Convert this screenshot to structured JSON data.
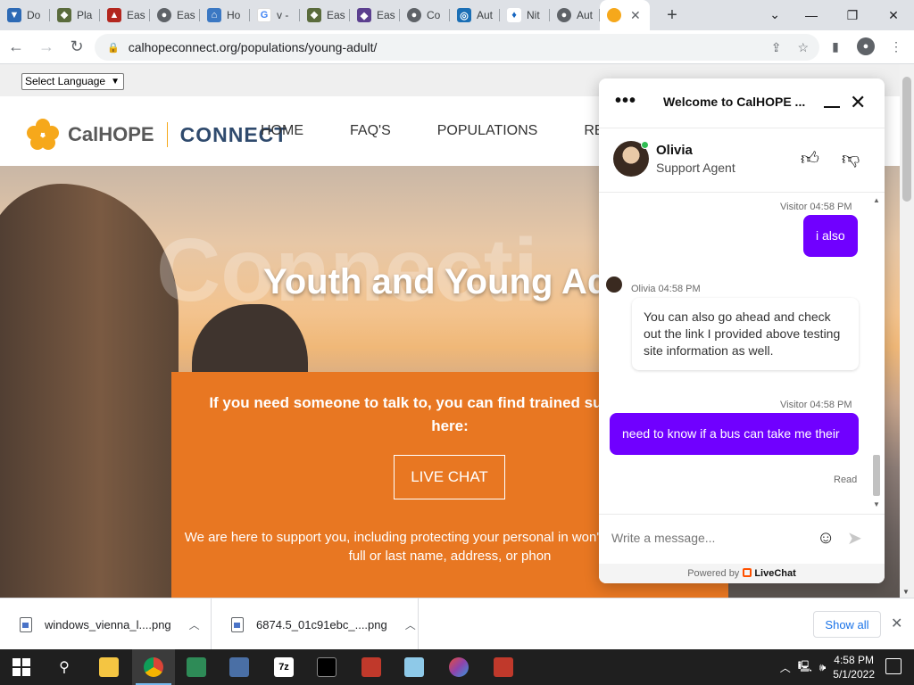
{
  "browser": {
    "tabs": [
      {
        "label": "Do",
        "color": "#2d6ab5"
      },
      {
        "label": "Pla",
        "color": "#5a6b3c"
      },
      {
        "label": "Eas",
        "color": "#b3261e"
      },
      {
        "label": "Eas",
        "color": "#5f6368"
      },
      {
        "label": "Ho",
        "color": "#3b78c3"
      },
      {
        "label": "v -",
        "color": "#4285f4"
      },
      {
        "label": "Eas",
        "color": "#5a6b3c"
      },
      {
        "label": "Eas",
        "color": "#5b3f8f"
      },
      {
        "label": "Co",
        "color": "#5f6368"
      },
      {
        "label": "Aut",
        "color": "#1b6fb5"
      },
      {
        "label": "Nit",
        "color": "#1565c0"
      },
      {
        "label": "Aut",
        "color": "#5f6368"
      }
    ],
    "active_tab_close": "✕",
    "new_tab": "+",
    "url": "calhopeconnect.org/populations/young-adult/"
  },
  "page": {
    "language_select": "Select Language",
    "logo": {
      "part1": "CalHOPE",
      "part2": "CONNECT"
    },
    "nav": [
      "HOME",
      "FAQ'S",
      "POPULATIONS",
      "RESO"
    ],
    "hero_ghost": "Connecti",
    "hero_title": "Youth and Young Adu",
    "orange_text": "If you need someone to talk to, you can find trained supp chat with here:",
    "live_chat_button": "LIVE CHAT",
    "support_text": "We are here to support you, including protecting your personal in won't be a need for your full or last name, address, or phon"
  },
  "chat": {
    "title": "Welcome to CalHOPE ...",
    "agent_name": "Olivia",
    "agent_role": "Support Agent",
    "messages": [
      {
        "meta": "Visitor 04:58 PM",
        "text": "i also"
      },
      {
        "meta": "Olivia 04:58 PM",
        "text": "You can also go ahead and check out the link I provided above testing site information as well."
      },
      {
        "meta": "Visitor 04:58 PM",
        "text": "need to know if a bus can take me their"
      }
    ],
    "read_status": "Read",
    "placeholder": "Write a message...",
    "powered_prefix": "Powered by",
    "powered_brand": "LiveChat"
  },
  "downloads": {
    "items": [
      "windows_vienna_l....png",
      "6874.5_01c91ebc_....png"
    ],
    "show_all": "Show all"
  },
  "taskbar": {
    "time": "4:58 PM",
    "date": "5/1/2022"
  }
}
